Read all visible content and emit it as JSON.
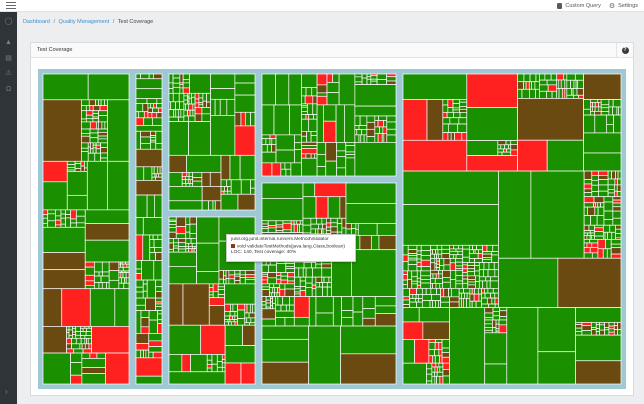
{
  "topbar": {
    "custom_query_label": "Custom Query",
    "settings_label": "Settings"
  },
  "breadcrumb": {
    "items": [
      "Dashboard",
      "Quality Management",
      "Test Coverage"
    ]
  },
  "panel": {
    "title": "Test Coverage",
    "help_symbol": "?"
  },
  "tooltip": {
    "class_name": "junit.org.junit.internal.runners.MethodValidator",
    "method": "void validateTestMethods(java.lang.Class,boolean)",
    "stats": "LOC: 140, Test coverage: 40%"
  },
  "colors": {
    "covered": "#1a8f00",
    "partial": "#6b4a12",
    "uncovered": "#ff2020",
    "group_border": "#9ec9d4",
    "cell_border": "#ffffff"
  },
  "sidebar": {
    "icons": [
      "circle-icon",
      "person-icon",
      "document-icon",
      "warning-icon",
      "headset-icon"
    ]
  }
}
